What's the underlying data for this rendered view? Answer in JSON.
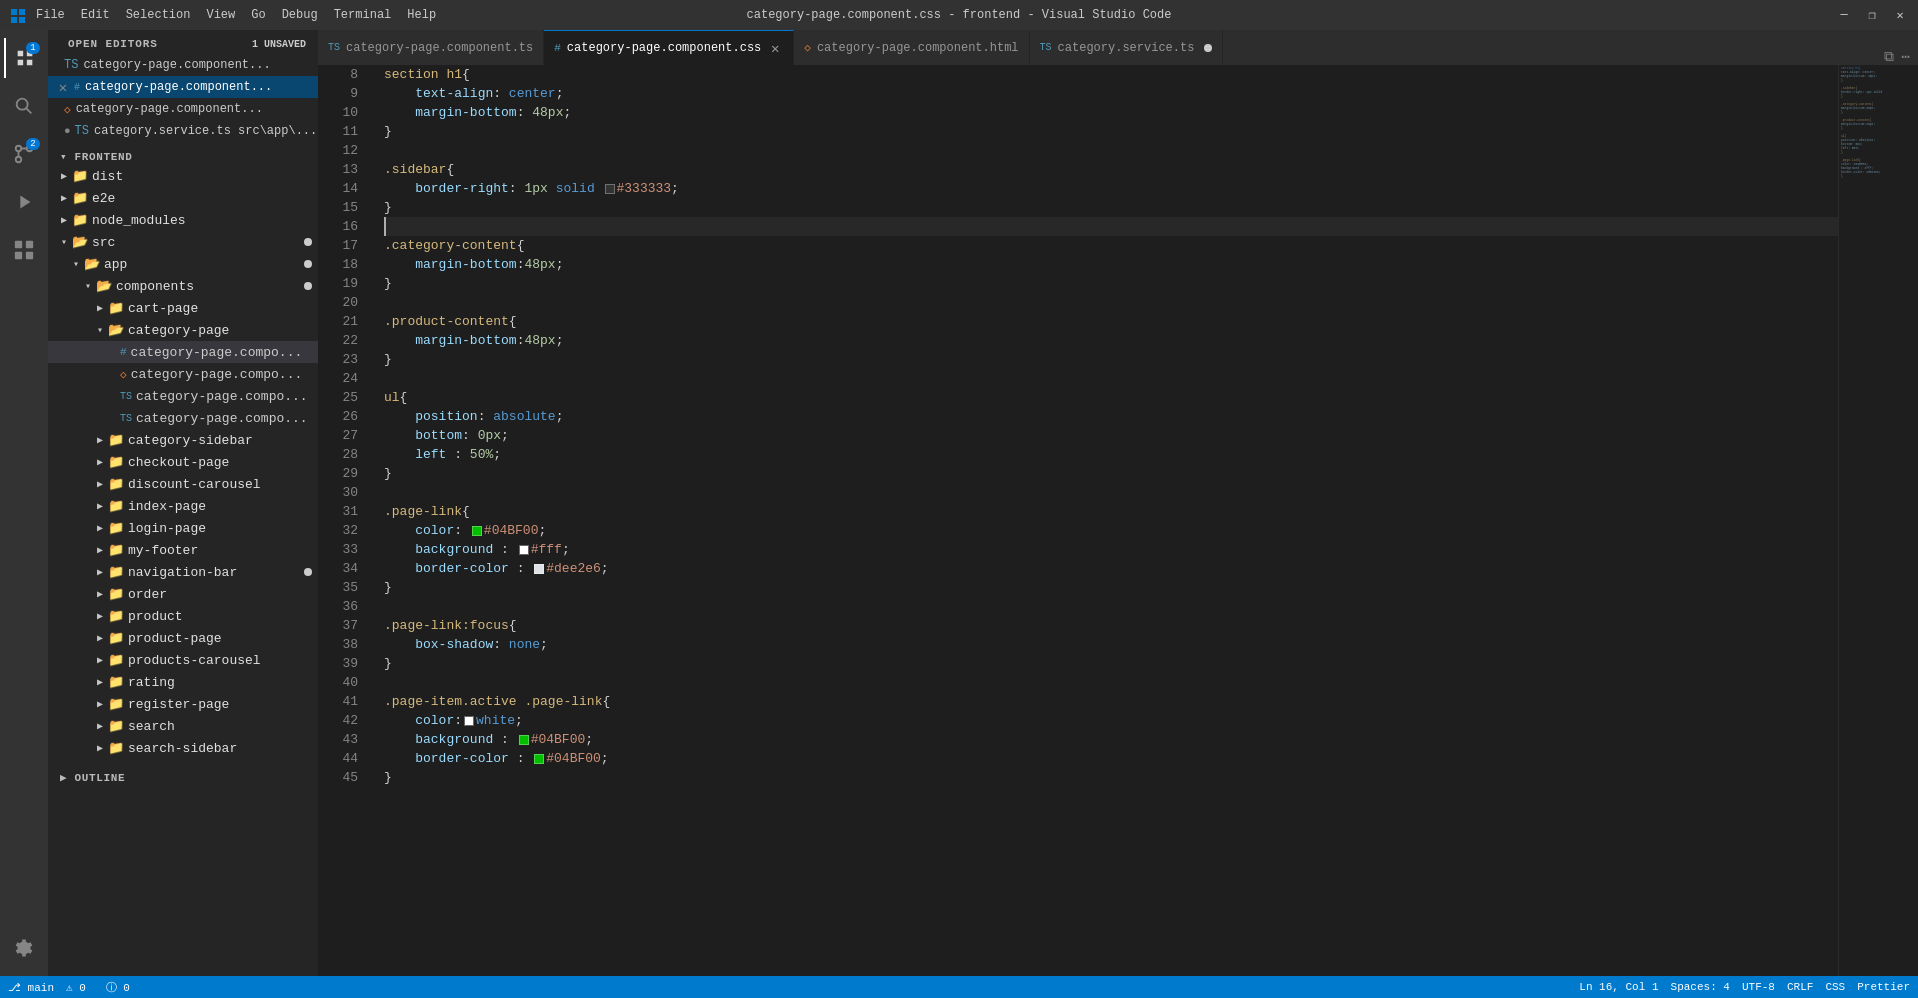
{
  "titleBar": {
    "menus": [
      "File",
      "Edit",
      "Selection",
      "View",
      "Go",
      "Debug",
      "Terminal",
      "Help"
    ],
    "title": "category-page.component.css - frontend - Visual Studio Code",
    "controls": [
      "—",
      "❐",
      "✕"
    ]
  },
  "activityBar": {
    "icons": [
      {
        "name": "explorer-icon",
        "symbol": "⎘",
        "active": true,
        "badge": "1"
      },
      {
        "name": "search-activity-icon",
        "symbol": "🔍"
      },
      {
        "name": "source-control-icon",
        "symbol": "⑂",
        "badge": "2"
      },
      {
        "name": "run-icon",
        "symbol": "▶"
      },
      {
        "name": "extensions-icon",
        "symbol": "⊞"
      }
    ],
    "bottomIcons": [
      {
        "name": "settings-icon",
        "symbol": "⚙"
      }
    ]
  },
  "sidebar": {
    "openEditors": {
      "title": "OPEN EDITORS",
      "badge": "1 UNSAVED",
      "files": [
        {
          "name": "category-page.component.ts",
          "type": "ts",
          "color": "#519aba"
        },
        {
          "name": "category-page.component.css",
          "type": "css",
          "color": "#519aba",
          "active": true,
          "hasClose": true
        },
        {
          "name": "category-page.component.html",
          "type": "html",
          "color": "#e37933"
        },
        {
          "name": "category.service.ts src\\app\\...",
          "type": "ts",
          "color": "#519aba",
          "modified": true
        }
      ]
    },
    "explorer": {
      "title": "FRONTEND",
      "items": [
        {
          "label": "dist",
          "indent": 1,
          "type": "folder",
          "collapsed": true
        },
        {
          "label": "e2e",
          "indent": 1,
          "type": "folder",
          "collapsed": true
        },
        {
          "label": "node_modules",
          "indent": 1,
          "type": "folder",
          "collapsed": true
        },
        {
          "label": "src",
          "indent": 1,
          "type": "folder",
          "collapsed": false,
          "dot": true
        },
        {
          "label": "app",
          "indent": 2,
          "type": "folder",
          "collapsed": false,
          "dot": true
        },
        {
          "label": "components",
          "indent": 3,
          "type": "folder",
          "collapsed": false,
          "dot": true
        },
        {
          "label": "cart-page",
          "indent": 4,
          "type": "folder",
          "collapsed": true
        },
        {
          "label": "category-page",
          "indent": 4,
          "type": "folder",
          "collapsed": false
        },
        {
          "label": "category-page.compo...",
          "indent": 5,
          "type": "css",
          "active": true
        },
        {
          "label": "category-page.compo...",
          "indent": 5,
          "type": "html"
        },
        {
          "label": "category-page.compo...",
          "indent": 5,
          "type": "ts"
        },
        {
          "label": "category-page.compo...",
          "indent": 5,
          "type": "ts"
        },
        {
          "label": "category-sidebar",
          "indent": 4,
          "type": "folder",
          "collapsed": true
        },
        {
          "label": "checkout-page",
          "indent": 4,
          "type": "folder",
          "collapsed": true
        },
        {
          "label": "discount-carousel",
          "indent": 4,
          "type": "folder",
          "collapsed": true
        },
        {
          "label": "index-page",
          "indent": 4,
          "type": "folder",
          "collapsed": true
        },
        {
          "label": "login-page",
          "indent": 4,
          "type": "folder",
          "collapsed": true
        },
        {
          "label": "my-footer",
          "indent": 4,
          "type": "folder",
          "collapsed": true
        },
        {
          "label": "navigation-bar",
          "indent": 4,
          "type": "folder",
          "collapsed": true,
          "dot": true
        },
        {
          "label": "order",
          "indent": 4,
          "type": "folder",
          "collapsed": true
        },
        {
          "label": "product",
          "indent": 4,
          "type": "folder",
          "collapsed": true
        },
        {
          "label": "product-page",
          "indent": 4,
          "type": "folder",
          "collapsed": true
        },
        {
          "label": "products-carousel",
          "indent": 4,
          "type": "folder",
          "collapsed": true
        },
        {
          "label": "rating",
          "indent": 4,
          "type": "folder",
          "collapsed": true
        },
        {
          "label": "register-page",
          "indent": 4,
          "type": "folder",
          "collapsed": true
        },
        {
          "label": "search",
          "indent": 4,
          "type": "folder",
          "collapsed": true
        },
        {
          "label": "search-sidebar",
          "indent": 4,
          "type": "folder",
          "collapsed": true
        }
      ]
    },
    "outline": {
      "title": "OUTLINE"
    }
  },
  "tabs": [
    {
      "label": "category-page.component.ts",
      "type": "ts",
      "active": false
    },
    {
      "label": "category-page.component.css",
      "type": "css",
      "active": true,
      "hasClose": true
    },
    {
      "label": "category-page.component.html",
      "type": "html",
      "active": false
    },
    {
      "label": "category.service.ts",
      "type": "ts",
      "active": false,
      "modified": true
    }
  ],
  "code": {
    "lines": [
      {
        "num": 8,
        "content": "section h1{"
      },
      {
        "num": 9,
        "content": "    text-align: center;"
      },
      {
        "num": 10,
        "content": "    margin-bottom: 48px;"
      },
      {
        "num": 11,
        "content": "}"
      },
      {
        "num": 12,
        "content": ""
      },
      {
        "num": 13,
        "content": ".sidebar{"
      },
      {
        "num": 14,
        "content": "    border-right: 1px solid #333333;"
      },
      {
        "num": 15,
        "content": "}"
      },
      {
        "num": 16,
        "content": ""
      },
      {
        "num": 17,
        "content": ".category-content{"
      },
      {
        "num": 18,
        "content": "    margin-bottom:48px;"
      },
      {
        "num": 19,
        "content": "}"
      },
      {
        "num": 20,
        "content": ""
      },
      {
        "num": 21,
        "content": ".product-content{"
      },
      {
        "num": 22,
        "content": "    margin-bottom:48px;"
      },
      {
        "num": 23,
        "content": "}"
      },
      {
        "num": 24,
        "content": ""
      },
      {
        "num": 25,
        "content": "ul{"
      },
      {
        "num": 26,
        "content": "    position: absolute;"
      },
      {
        "num": 27,
        "content": "    bottom: 0px;"
      },
      {
        "num": 28,
        "content": "    left : 50%;"
      },
      {
        "num": 29,
        "content": "}"
      },
      {
        "num": 30,
        "content": ""
      },
      {
        "num": 31,
        "content": ".page-link{"
      },
      {
        "num": 32,
        "content": "    color: #04BF00;"
      },
      {
        "num": 33,
        "content": "    background : #fff;"
      },
      {
        "num": 34,
        "content": "    border-color : #dee2e6;"
      },
      {
        "num": 35,
        "content": "}"
      },
      {
        "num": 36,
        "content": ""
      },
      {
        "num": 37,
        "content": ".page-link:focus{"
      },
      {
        "num": 38,
        "content": "    box-shadow: none;"
      },
      {
        "num": 39,
        "content": "}"
      },
      {
        "num": 40,
        "content": ""
      },
      {
        "num": 41,
        "content": ".page-item.active .page-link{"
      },
      {
        "num": 42,
        "content": "    color: white;"
      },
      {
        "num": 43,
        "content": "    background : #04BF00;"
      },
      {
        "num": 44,
        "content": "    border-color : #04BF00;"
      },
      {
        "num": 45,
        "content": "}"
      }
    ]
  },
  "statusBar": {
    "left": [
      "⎇ main",
      "⚠ 0  ⓘ 0"
    ],
    "right": [
      "Ln 16, Col 1",
      "Spaces: 4",
      "UTF-8",
      "CRLF",
      "CSS",
      "Prettier"
    ]
  }
}
